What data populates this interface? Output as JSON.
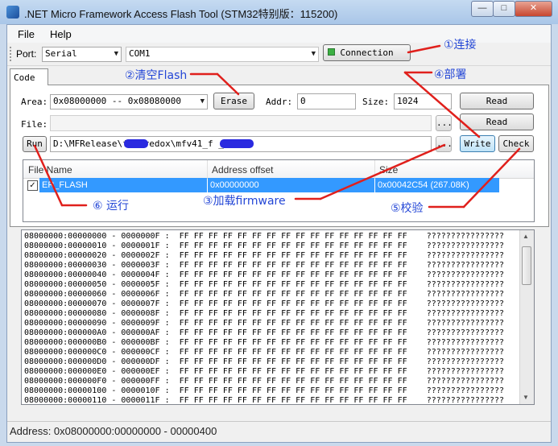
{
  "window": {
    "title": ".NET Micro Framework Access Flash Tool (STM32特别版：115200)"
  },
  "menu": {
    "file": "File",
    "help": "Help"
  },
  "toolbar": {
    "port_label": "Port:",
    "port_value": "Serial",
    "com_value": "COM1",
    "connection_label": "Connection"
  },
  "tabs": [
    "Code"
  ],
  "code": {
    "area_label": "Area:",
    "area_value": "0x08000000 -- 0x08080000",
    "erase_label": "Erase",
    "addr_label": "Addr:",
    "addr_value": "0",
    "size_label": "Size:",
    "size_value": "1024",
    "read_label": "Read",
    "file_label": "File:",
    "browse_label": "...",
    "read2_label": "Read",
    "run_label": "Run",
    "path_value": "D:\\MFRelease\\f        e\\redox\\mfv41_f         _redox",
    "write_label": "Write",
    "check_label": "Check"
  },
  "grid": {
    "columns": [
      "File Name",
      "Address offset",
      "Size"
    ],
    "rows": [
      {
        "checked": true,
        "name": "ER_FLASH",
        "offset": "0x00000000",
        "size": "0x00042C54 (267.08K)"
      }
    ]
  },
  "dump": {
    "bytes": "FF FF FF FF FF FF FF FF FF FF FF FF FF FF FF FF",
    "ascii": "????????????????",
    "lines": [
      "08000000:00000000 - 0000000F",
      "08000000:00000010 - 0000001F",
      "08000000:00000020 - 0000002F",
      "08000000:00000030 - 0000003F",
      "08000000:00000040 - 0000004F",
      "08000000:00000050 - 0000005F",
      "08000000:00000060 - 0000006F",
      "08000000:00000070 - 0000007F",
      "08000000:00000080 - 0000008F",
      "08000000:00000090 - 0000009F",
      "08000000:000000A0 - 000000AF",
      "08000000:000000B0 - 000000BF",
      "08000000:000000C0 - 000000CF",
      "08000000:000000D0 - 000000DF",
      "08000000:000000E0 - 000000EF",
      "08000000:000000F0 - 000000FF",
      "08000000:00000100 - 0000010F",
      "08000000:00000110 - 0000011F"
    ]
  },
  "status": {
    "text": "Address: 0x08000000:00000000 - 00000400"
  },
  "annotations": {
    "connect": "①连接",
    "erase": "②清空Flash",
    "load": "③加载firmware",
    "deploy": "④部署",
    "verify": "⑤校验",
    "run": "⑥ 运行"
  },
  "colors": {
    "annotation": "#2346d6",
    "arrow": "#e0201c",
    "selection": "#3399ff",
    "redaction": "#2a2ae0"
  }
}
